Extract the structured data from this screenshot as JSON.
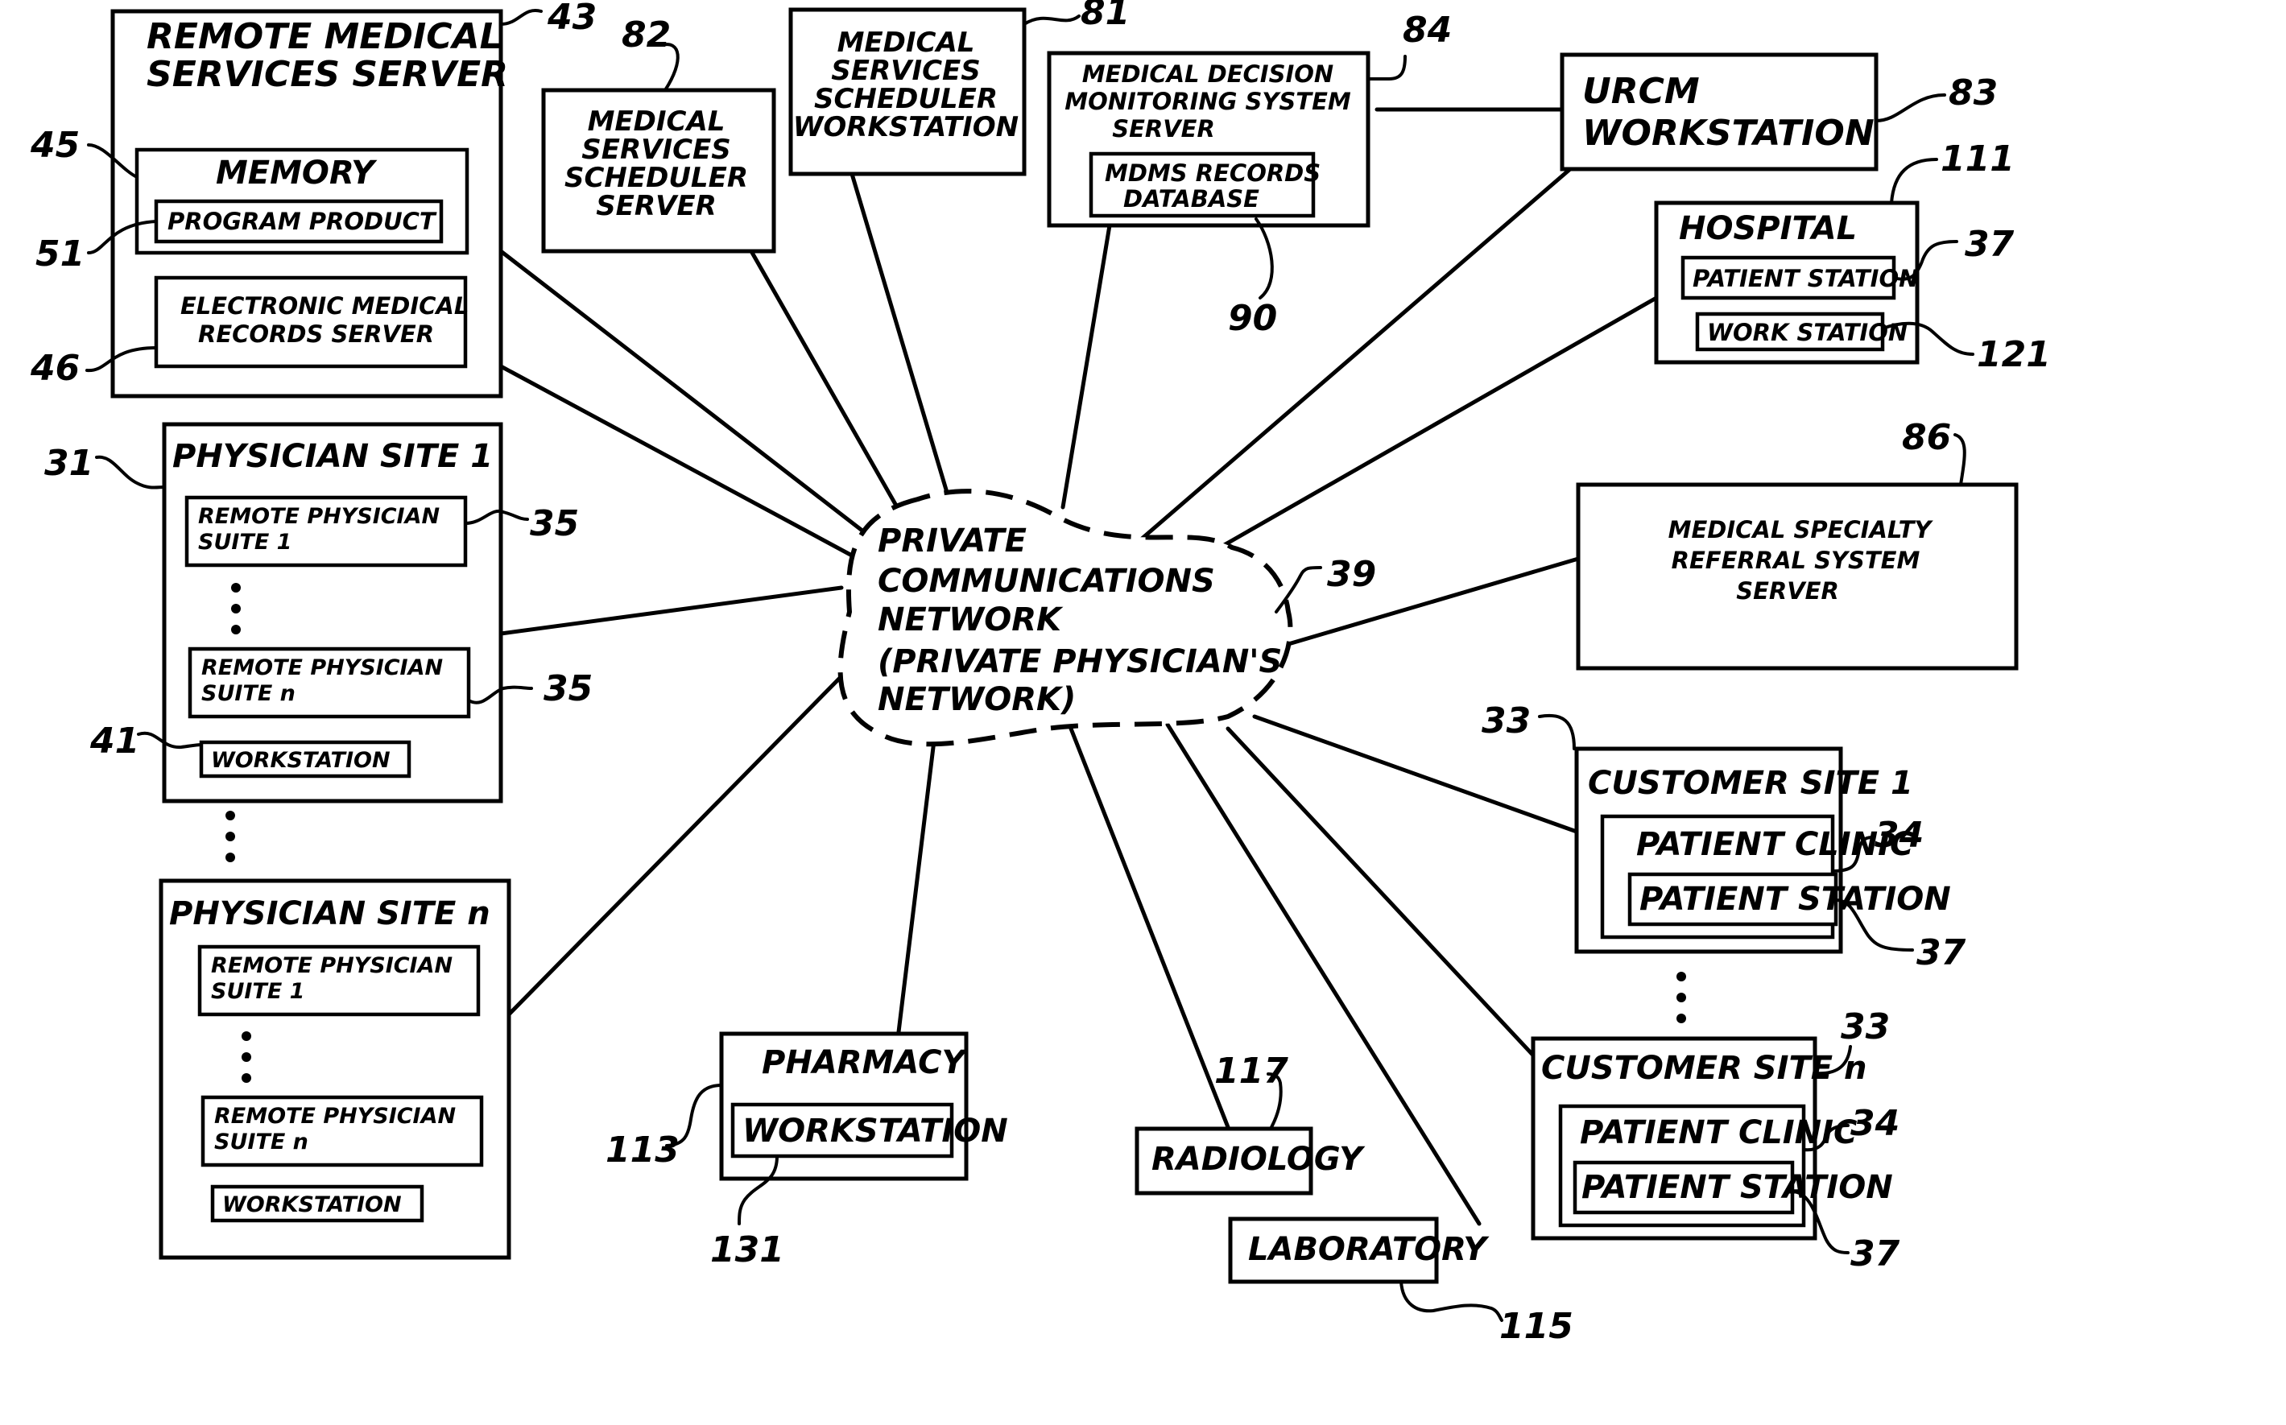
{
  "diagram": {
    "type": "network-architecture",
    "hub": {
      "ref": "39",
      "lines": [
        "PRIVATE",
        "COMMUNICATIONS",
        "NETWORK",
        "(PRIVATE PHYSICIAN'S",
        "NETWORK)"
      ]
    },
    "remote_server": {
      "ref": "43",
      "title_lines": [
        "REMOTE MEDICAL",
        "SERVICES SERVER"
      ],
      "memory": {
        "ref": "45",
        "label": "MEMORY",
        "program_product": {
          "ref": "51",
          "label": "PROGRAM PRODUCT"
        }
      },
      "emr_server": {
        "ref": "46",
        "lines": [
          "ELECTRONIC MEDICAL",
          "RECORDS SERVER"
        ]
      }
    },
    "scheduler_server": {
      "ref": "82",
      "lines": [
        "MEDICAL",
        "SERVICES",
        "SCHEDULER",
        "SERVER"
      ]
    },
    "scheduler_workstation": {
      "ref": "81",
      "lines": [
        "MEDICAL",
        "SERVICES",
        "SCHEDULER",
        "WORKSTATION"
      ]
    },
    "mdms_server": {
      "ref": "84",
      "lines": [
        "MEDICAL DECISION",
        "MONITORING SYSTEM",
        "SERVER"
      ],
      "database": {
        "ref": "90",
        "lines": [
          "MDMS RECORDS",
          "DATABASE"
        ]
      }
    },
    "urcm_workstation": {
      "ref": "83",
      "lines": [
        "URCM",
        "WORKSTATION"
      ]
    },
    "hospital": {
      "ref": "111",
      "label": "HOSPITAL",
      "patient_station": {
        "ref": "37",
        "label": "PATIENT STATION"
      },
      "work_station": {
        "ref": "121",
        "label": "WORK STATION"
      }
    },
    "referral_server": {
      "ref": "86",
      "lines": [
        "MEDICAL SPECIALTY",
        "REFERRAL SYSTEM",
        "SERVER"
      ]
    },
    "physician_sites": [
      {
        "ref": "31",
        "label": "PHYSICIAN SITE 1",
        "suite_first": {
          "ref": "35",
          "lines": [
            "REMOTE PHYSICIAN",
            "SUITE 1"
          ]
        },
        "suite_last": {
          "ref": "35",
          "lines": [
            "REMOTE PHYSICIAN",
            "SUITE n"
          ]
        },
        "workstation": {
          "ref": "41",
          "label": "WORKSTATION"
        }
      },
      {
        "label": "PHYSICIAN SITE n",
        "suite_first": {
          "lines": [
            "REMOTE PHYSICIAN",
            "SUITE 1"
          ]
        },
        "suite_last": {
          "lines": [
            "REMOTE PHYSICIAN",
            "SUITE n"
          ]
        },
        "workstation": {
          "label": "WORKSTATION"
        }
      }
    ],
    "customer_sites": [
      {
        "ref": "33",
        "label": "CUSTOMER SITE 1",
        "clinic": {
          "ref": "34",
          "label": "PATIENT CLINIC"
        },
        "station": {
          "ref": "37",
          "label": "PATIENT STATION"
        }
      },
      {
        "ref": "33",
        "label": "CUSTOMER SITE  n",
        "clinic": {
          "ref": "34",
          "label": "PATIENT CLINIC"
        },
        "station": {
          "ref": "37",
          "label": "PATIENT STATION"
        }
      }
    ],
    "pharmacy": {
      "ref": "113",
      "label": "PHARMACY",
      "workstation": {
        "ref": "131",
        "label": "WORKSTATION"
      }
    },
    "radiology": {
      "ref": "117",
      "label": "RADIOLOGY"
    },
    "laboratory": {
      "ref": "115",
      "label": "LABORATORY"
    }
  }
}
